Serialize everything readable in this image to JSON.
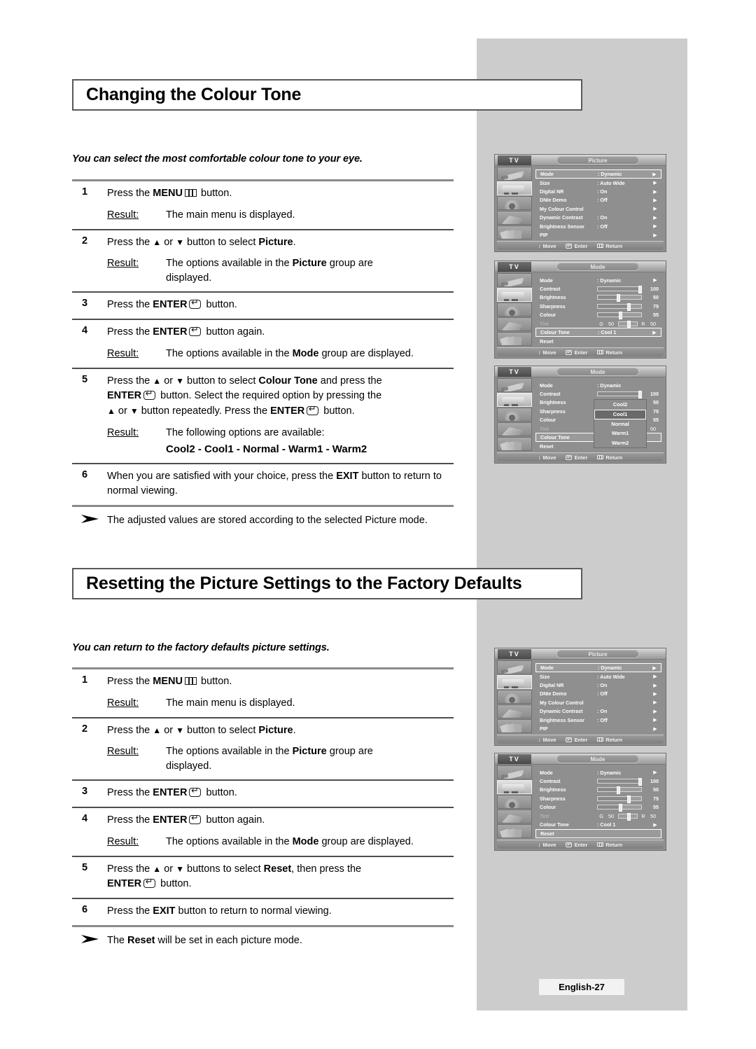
{
  "page": {
    "footer_label": "English-27"
  },
  "sections": [
    {
      "id": "colour-tone",
      "title": "Changing the Colour Tone",
      "intro": "You can select the most comfortable colour tone to your eye.",
      "steps": [
        {
          "num": "1",
          "text_pre": "Press the ",
          "bold1": "MENU",
          "glyph": "menu-icon",
          "text_post": " button.",
          "result_label": "Result:",
          "result_text": "The main menu is displayed."
        },
        {
          "num": "2",
          "text": "Press the ▲ or ▼ button to select Picture.",
          "result_label": "Result:",
          "result_text": "The options available in the Picture group are displayed."
        },
        {
          "num": "3",
          "text": "Press the ENTER button.",
          "result_label": "",
          "result_text": ""
        },
        {
          "num": "4",
          "text": "Press the ENTER button again.",
          "result_label": "Result:",
          "result_text": "The options available in the Mode group are displayed."
        },
        {
          "num": "5",
          "text": "Press the ▲ or ▼ button to select Colour Tone and press the ENTER button. Select the required option by pressing the ▲ or ▼ button repeatedly. Press the ENTER button.",
          "result_label": "Result:",
          "result_text": "The following options are available:",
          "result_options": "Cool2 - Cool1 - Normal - Warm1 - Warm2"
        },
        {
          "num": "6",
          "text": "When you are satisfied with your choice, press the EXIT button to return to normal viewing.",
          "result_label": "",
          "result_text": ""
        }
      ],
      "note": "The adjusted values are stored according to the selected Picture mode."
    },
    {
      "id": "reset-picture",
      "title": "Resetting the Picture Settings to the Factory Defaults",
      "intro": "You can return to the factory defaults picture settings.",
      "steps": [
        {
          "num": "1",
          "result_label": "Result:",
          "result_text": "The main menu is displayed."
        },
        {
          "num": "2",
          "result_label": "Result:",
          "result_text": "The options available in the Picture group are displayed."
        },
        {
          "num": "3"
        },
        {
          "num": "4",
          "result_label": "Result:",
          "result_text": "The options available in the Mode group are displayed."
        },
        {
          "num": "5"
        },
        {
          "num": "6"
        }
      ],
      "note": "The Reset will be set in each picture mode."
    }
  ],
  "words": {
    "press_the": "Press the ",
    "or": " or ",
    "button": " button.",
    "button_again": " button again.",
    "menu": "MENU",
    "enter": "ENTER",
    "exit": "EXIT",
    "picture": "Picture",
    "mode": "Mode",
    "reset": "Reset",
    "colour_tone": "Colour Tone",
    "to_select": " button to select ",
    "buttons_to_select": " buttons to select ",
    "group_are_displayed": " group are displayed.",
    "group_are": " group are",
    "displayed": "displayed.",
    "and_press_the": " and press the",
    "select_required": " button. Select the required option by pressing the",
    "repeatedly": " button repeatedly. Press the ",
    "satisfied": "When you are satisfied with your choice, press the ",
    "button_to_return": " button to return to normal viewing.",
    "press_exit": "Press the ",
    "then_press_the": ", then press the",
    "note_adjusted": "The adjusted values are stored according to the selected Picture mode.",
    "note_reset_a": "The ",
    "note_reset_b": " will be set in each picture mode.",
    "result": "Result:",
    "following_options": "The following options are available:",
    "options_list": "Cool2 - Cool1 - Normal - Warm1 - Warm2"
  },
  "osd": {
    "tv_label": "TV",
    "footer": {
      "move": "Move",
      "enter": "Enter",
      "return": "Return"
    },
    "picture_screen": {
      "caption": "Picture",
      "rows": [
        {
          "label": "Mode",
          "value": ": Dynamic",
          "arrow": "▶",
          "highlight": true
        },
        {
          "label": "Size",
          "value": ": Auto Wide",
          "arrow": "▶"
        },
        {
          "label": "Digital NR",
          "value": ": On",
          "arrow": "▶"
        },
        {
          "label": "DNIe Demo",
          "value": ": Off",
          "arrow": "▶"
        },
        {
          "label": "My Colour Control",
          "value": "",
          "arrow": "▶"
        },
        {
          "label": "Dynamic Contrast",
          "value": ": On",
          "arrow": "▶"
        },
        {
          "label": "Brightness Sensor",
          "value": ": Off",
          "arrow": "▶"
        },
        {
          "label": "PIP",
          "value": "",
          "arrow": "▶"
        }
      ]
    },
    "mode_screen": {
      "caption": "Mode",
      "mode_label": "Mode",
      "mode_value": ": Dynamic",
      "sliders": [
        {
          "label": "Contrast",
          "value": "100",
          "pct": 97
        },
        {
          "label": "Brightness",
          "value": "50",
          "pct": 46
        },
        {
          "label": "Sharpness",
          "value": "75",
          "pct": 70
        },
        {
          "label": "Colour",
          "value": "55",
          "pct": 50
        }
      ],
      "tint": {
        "label": "Tint",
        "left_tag": "G",
        "left_value": "50",
        "right_tag": "R",
        "right_value": "50",
        "pct": 50
      },
      "colour_tone": {
        "label": "Colour Tone",
        "value": ": Cool 1",
        "arrow": "▶"
      },
      "reset": {
        "label": "Reset"
      }
    },
    "dropdown": {
      "options": [
        "Cool2",
        "Cool1",
        "Normal",
        "Warm1",
        "Warm2"
      ],
      "selected": "Cool1"
    },
    "icons": [
      "tuner-icon",
      "tv-picture-icon",
      "speaker-icon",
      "setup-icon",
      "cards-icon"
    ],
    "selected_icon_index": 1
  }
}
